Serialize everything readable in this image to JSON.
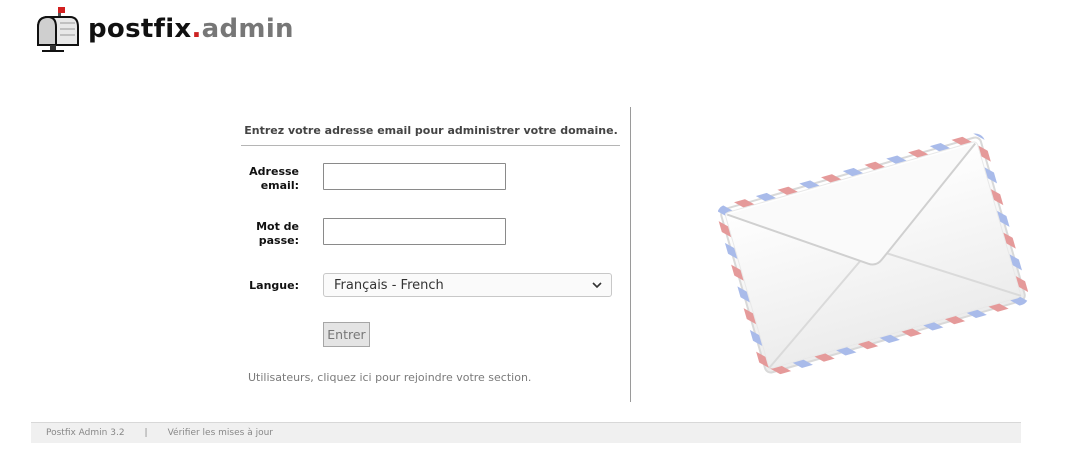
{
  "logo": {
    "part1": "postfix",
    "dot": ".",
    "part2": "admin",
    "icon": "mailbox-icon"
  },
  "login": {
    "intro": "Entrez votre adresse email pour administrer votre domaine.",
    "email_label_line1": "Adresse",
    "email_label_line2": "email:",
    "email_value": "",
    "password_label_line1": "Mot de",
    "password_label_line2": "passe:",
    "password_value": "",
    "language_label": "Langue:",
    "language_selected": "Français - French",
    "submit_label": "Entrer",
    "user_link": "Utilisateurs, cliquez ici pour rejoindre votre section."
  },
  "illustration": {
    "icon": "envelope-icon"
  },
  "footer": {
    "version": "Postfix Admin 3.2",
    "separator": "|",
    "update_link": "Vérifier les mises à jour"
  },
  "colors": {
    "logo_dot": "#cc2222",
    "logo_admin": "#777777",
    "airmail_red": "#e08b8b",
    "airmail_blue": "#9fb3e8"
  }
}
